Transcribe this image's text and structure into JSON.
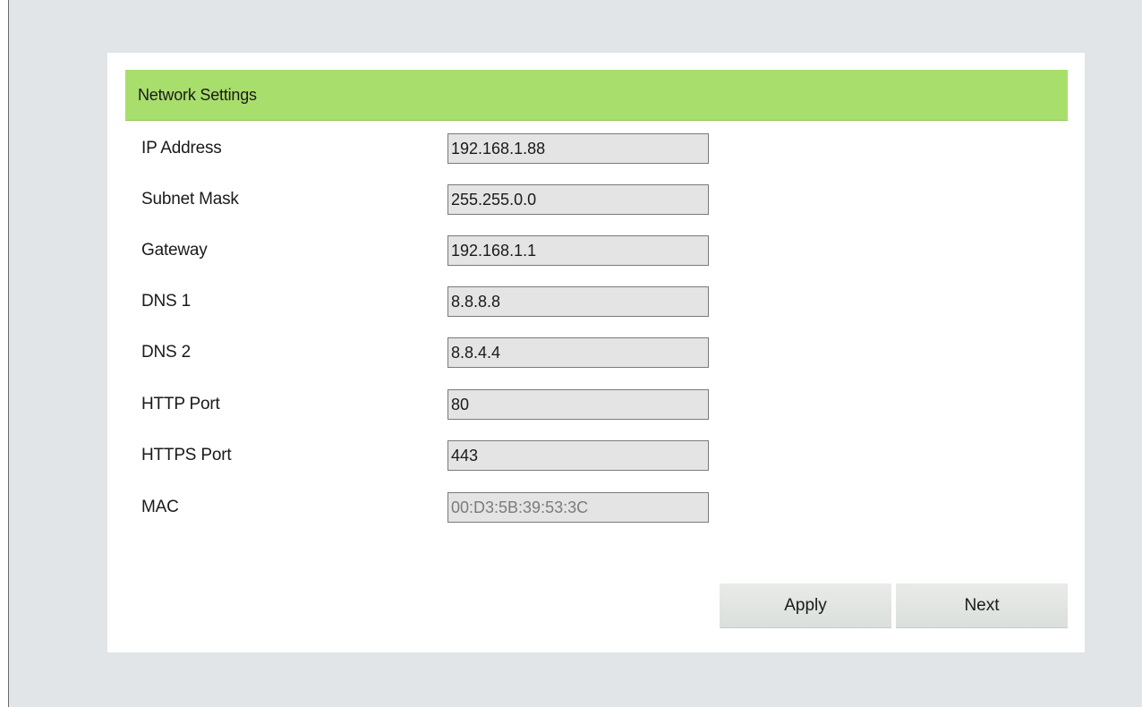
{
  "section": {
    "title": "Network Settings"
  },
  "fields": [
    {
      "label": "IP Address",
      "value": "192.168.1.88",
      "readonly": false
    },
    {
      "label": "Subnet Mask",
      "value": "255.255.0.0",
      "readonly": false
    },
    {
      "label": "Gateway",
      "value": "192.168.1.1",
      "readonly": false
    },
    {
      "label": "DNS 1",
      "value": "8.8.8.8",
      "readonly": false
    },
    {
      "label": "DNS 2",
      "value": "8.8.4.4",
      "readonly": false
    },
    {
      "label": "HTTP Port",
      "value": "80",
      "readonly": false
    },
    {
      "label": "HTTPS Port",
      "value": "443",
      "readonly": false
    },
    {
      "label": "MAC",
      "value": "00:D3:5B:39:53:3C",
      "readonly": true
    }
  ],
  "buttons": {
    "apply_label": "Apply",
    "next_label": "Next"
  },
  "colors": {
    "header_bg": "#a8de6c",
    "page_bg": "#e1e5e8",
    "field_bg": "#e4e4e4"
  }
}
